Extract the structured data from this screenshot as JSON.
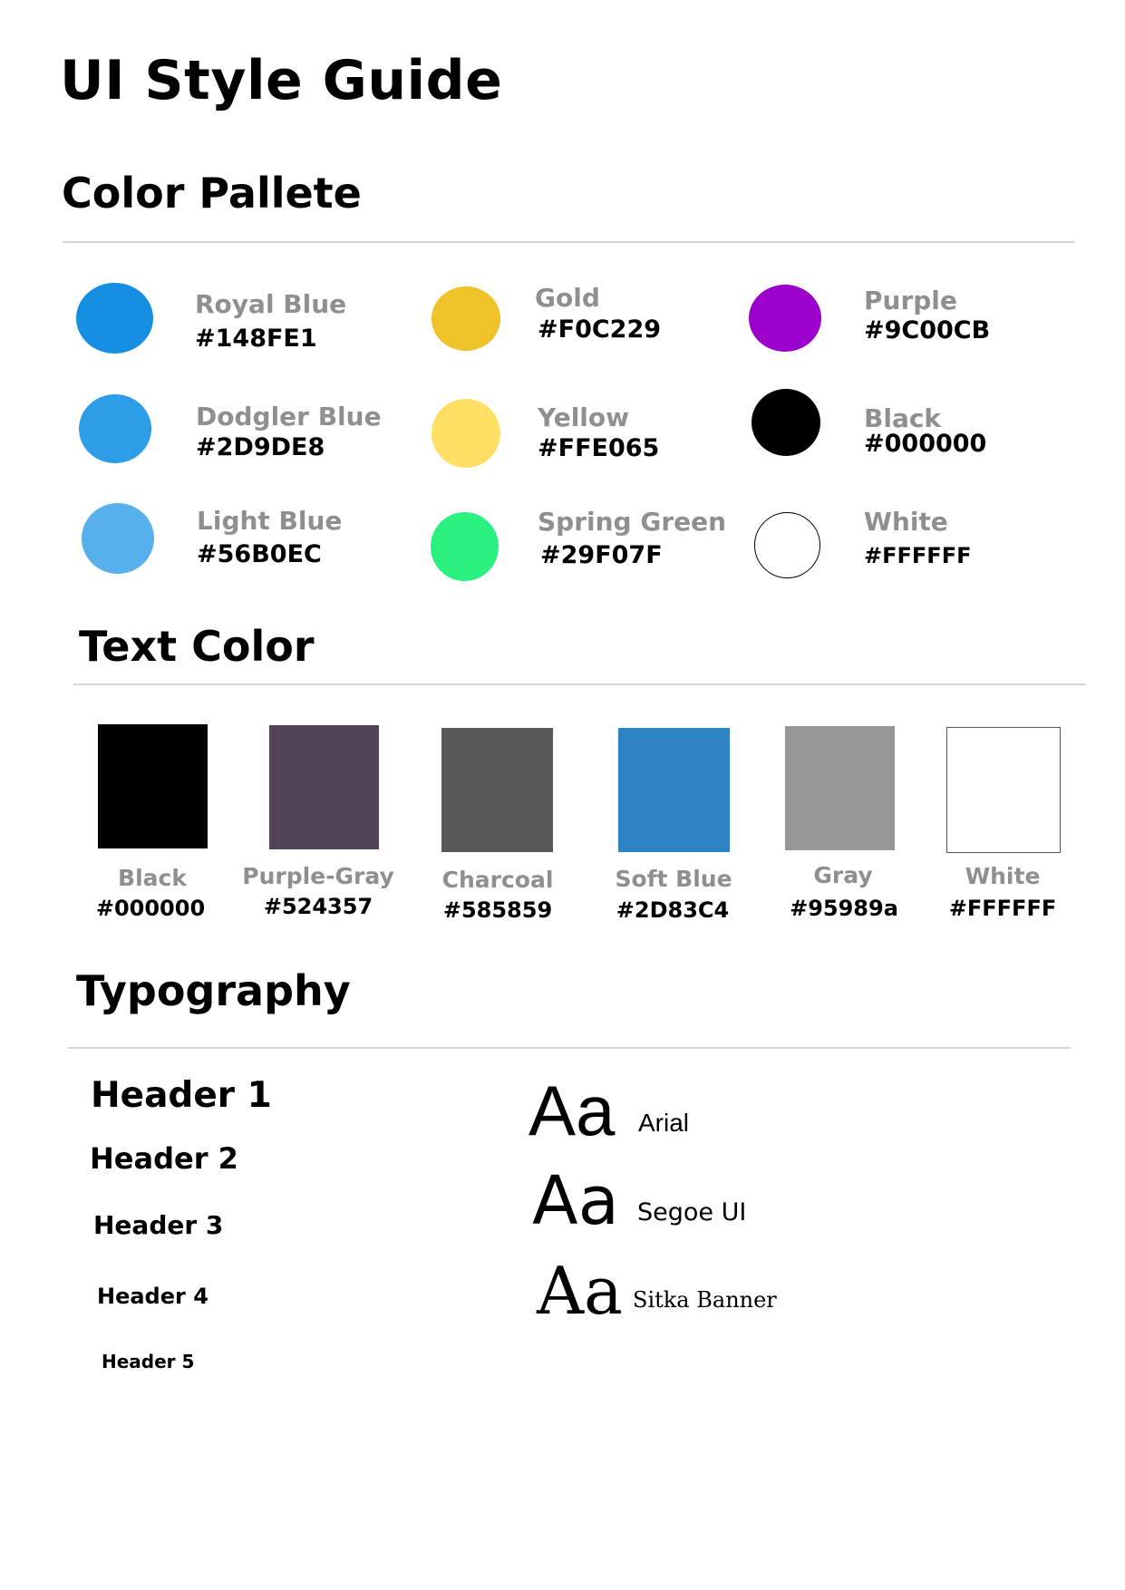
{
  "title": "UI Style Guide",
  "palette": {
    "heading": "Color Pallete",
    "colors": [
      {
        "name": "Royal Blue",
        "hex": "#148FE1"
      },
      {
        "name": "Dodgler Blue",
        "hex": "#2D9DE8"
      },
      {
        "name": "Light Blue",
        "hex": "#56B0EC"
      },
      {
        "name": "Gold",
        "hex": "#F0C229"
      },
      {
        "name": "Yellow",
        "hex": "#FFE065"
      },
      {
        "name": "Spring Green",
        "hex": "#29F07F"
      },
      {
        "name": "Purple",
        "hex": "#9C00CB"
      },
      {
        "name": "Black",
        "hex": "#000000"
      },
      {
        "name": "White",
        "hex": "#FFFFFF"
      }
    ]
  },
  "text_colors": {
    "heading": "Text Color",
    "colors": [
      {
        "name": "Black",
        "hex": "#000000"
      },
      {
        "name": "Purple-Gray",
        "hex": "#524357"
      },
      {
        "name": "Charcoal",
        "hex": "#585859"
      },
      {
        "name": "Soft Blue",
        "hex": "#2D83C4"
      },
      {
        "name": "Gray",
        "hex": "#95989a"
      },
      {
        "name": "White",
        "hex": "#FFFFFF"
      }
    ]
  },
  "typography": {
    "heading": "Typography",
    "headers": [
      "Header 1",
      "Header 2",
      "Header 3",
      "Header 4",
      "Header 5"
    ],
    "fonts": [
      {
        "sample": "Aa",
        "name": "Arial"
      },
      {
        "sample": "Aa",
        "name": "Segoe UI"
      },
      {
        "sample": "Aa",
        "name": "Sitka Banner"
      }
    ]
  }
}
